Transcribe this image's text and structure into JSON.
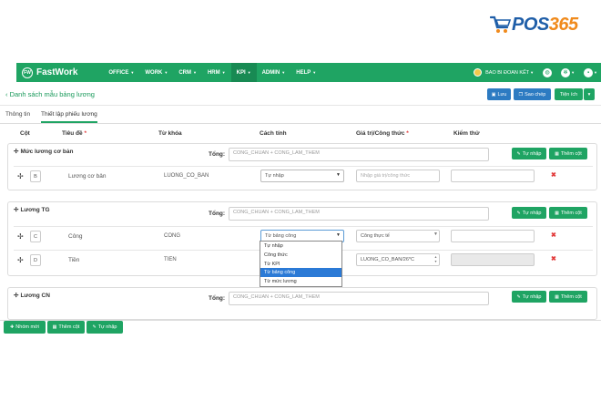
{
  "brand": {
    "logo_text_a": "POS",
    "logo_text_b": "365"
  },
  "topnav": {
    "app_name": "FastWork",
    "logo_badge": "FW",
    "menu": [
      {
        "label": "OFFICE"
      },
      {
        "label": "WORK"
      },
      {
        "label": "CRM"
      },
      {
        "label": "HRM"
      },
      {
        "label": "KPI"
      },
      {
        "label": "ADMIN"
      },
      {
        "label": "HELP"
      }
    ],
    "company": "BAO BI ĐOAN KẾT"
  },
  "header": {
    "breadcrumb": "‹ Danh sách mẫu bảng lương",
    "save_label": "Lưu",
    "copy_label": "Sao chép",
    "utility_label": "Tiện ích"
  },
  "tabs": [
    {
      "label": "Thông tin"
    },
    {
      "label": "Thiết lập phiếu lương"
    }
  ],
  "columns": {
    "col": "Cột",
    "title": "Tiêu đề",
    "keyword": "Từ khóa",
    "method": "Cách tính",
    "value": "Giá trị/Công thức",
    "test": "Kiểm thử",
    "required_mark": "*"
  },
  "sections": [
    {
      "title": "Mức lương cơ bản",
      "total_label": "Tổng:",
      "total_value": "CONG_CHUAN + CONG_LAM_THEM",
      "import_label": "Tự nhập",
      "add_col_label": "Thêm cột",
      "rows": [
        {
          "key": "B",
          "title": "Lương cơ bản",
          "keyword": "LUONG_CO_BAN",
          "method": "Tự nhập",
          "value": "Nhập giá trị/công thức"
        }
      ]
    },
    {
      "title": "Lương TG",
      "total_label": "Tổng:",
      "total_value": "CONG_CHUAN + CONG_LAM_THEM",
      "import_label": "Tự nhập",
      "add_col_label": "Thêm cột",
      "rows": [
        {
          "key": "C",
          "title": "Công",
          "keyword": "CONG",
          "method": "Từ bảng công",
          "value": "Công thực tế"
        },
        {
          "key": "D",
          "title": "Tiền",
          "keyword": "TIEN",
          "method": "",
          "value": "LUONG_CO_BAN/26*C"
        }
      ]
    },
    {
      "title": "Lương CN",
      "total_label": "Tổng:",
      "total_value": "CONG_CHUAN + CONG_LAM_THEM",
      "import_label": "Tự nhập",
      "add_col_label": "Thêm cột"
    }
  ],
  "dropdown": {
    "options": [
      {
        "label": "Tự nhập"
      },
      {
        "label": "Công thức"
      },
      {
        "label": "Từ KPI"
      },
      {
        "label": "Từ bảng công"
      },
      {
        "label": "Từ mức lương"
      }
    ],
    "selected": "Từ bảng công"
  },
  "bottombar": {
    "new_group_label": "Nhóm mới",
    "add_col_label": "Thêm cột",
    "import_label": "Tự nhập"
  },
  "colors": {
    "brand_green": "#1fa463",
    "brand_blue": "#2d7bc2",
    "delete_red": "#e23b3b",
    "logo_blue": "#1f5ea8",
    "logo_orange": "#f08a1c"
  },
  "icons": [
    "cart-logo-icon",
    "move-icon",
    "delete-icon",
    "save-icon",
    "copy-icon",
    "plus-icon",
    "table-icon",
    "edit-icon",
    "globe-icon",
    "gear-icon",
    "chat-icon",
    "chevron-down-icon"
  ]
}
